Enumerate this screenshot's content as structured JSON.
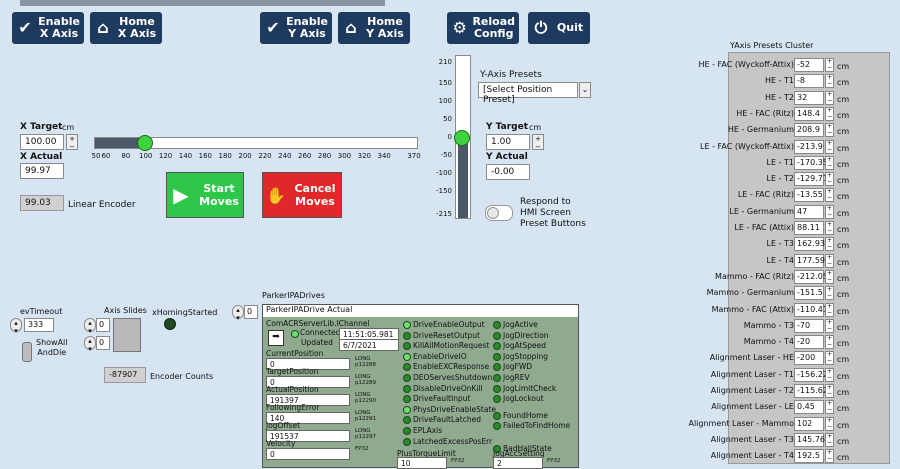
{
  "toolbar": {
    "enable_x": "Enable\nX Axis",
    "home_x": "Home\nX Axis",
    "enable_y": "Enable\nY Axis",
    "home_y": "Home\nY Axis",
    "reload": "Reload\nConfig",
    "quit": "Quit"
  },
  "xaxis": {
    "target_label": "X Target",
    "target_unit": "cm",
    "target_value": "100.00",
    "actual_label": "X Actual",
    "actual_value": "99.97",
    "encoder_value": "99.03",
    "encoder_label": "Linear Encoder",
    "slider_level": 100,
    "slider_min": 50,
    "slider_max": 370,
    "scale": [
      "50",
      "60",
      "80",
      "100",
      "120",
      "140",
      "160",
      "180",
      "200",
      "220",
      "240",
      "260",
      "280",
      "300",
      "320",
      "340",
      "370"
    ]
  },
  "moves": {
    "start": "Start\nMoves",
    "cancel": "Cancel\nMoves"
  },
  "yaxis": {
    "scale": [
      "210",
      "150",
      "100",
      "50",
      "0",
      "-50",
      "-100",
      "-150",
      "-215"
    ],
    "slider_level": 0,
    "presets_label": "Y-Axis Presets",
    "presets_selected": "[Select Position Preset]",
    "target_label": "Y Target",
    "target_unit": "cm",
    "target_value": "1.00",
    "actual_label": "Y Actual",
    "actual_value": "-0.00",
    "respond_label": "Respond to\nHMI Screen\nPreset Buttons"
  },
  "cluster": {
    "title": "YAxis Presets Cluster",
    "unit": "cm",
    "rows": [
      {
        "label": "HE - FAC (Wyckoff-Attix)",
        "value": "-52"
      },
      {
        "label": "HE - T1",
        "value": "-8"
      },
      {
        "label": "HE - T2",
        "value": "32"
      },
      {
        "label": "HE - FAC (Ritz)",
        "value": "148.4"
      },
      {
        "label": "HE - Germanium",
        "value": "208.9"
      },
      {
        "label": "LE - FAC (Wyckoff-Attix)",
        "value": "-213.9"
      },
      {
        "label": "LE - T1",
        "value": "-170.35"
      },
      {
        "label": "LE - T2",
        "value": "-129.71"
      },
      {
        "label": "LE - FAC (Ritz)",
        "value": "-13.55"
      },
      {
        "label": "LE - Germanium",
        "value": "47"
      },
      {
        "label": "LE - FAC (Attix)",
        "value": "88.11"
      },
      {
        "label": "LE - T3",
        "value": "162.93"
      },
      {
        "label": "LE - T4",
        "value": "177.59"
      },
      {
        "label": "Mammo - FAC (Ritz)",
        "value": "-212.05"
      },
      {
        "label": "Mammo - Germanium",
        "value": "-151.5"
      },
      {
        "label": "Mammo - FAC (Attix)",
        "value": "-110.41"
      },
      {
        "label": "Mammo - T3",
        "value": "-70"
      },
      {
        "label": "Mammo - T4",
        "value": "-20"
      },
      {
        "label": "Alignment Laser - HE",
        "value": "-200"
      },
      {
        "label": "Alignment Laser - T1",
        "value": "-156.22"
      },
      {
        "label": "Alignment Laser - T2",
        "value": "-115.62"
      },
      {
        "label": "Alignment Laser - LE",
        "value": "0.45"
      },
      {
        "label": "Alignment Laser - Mammo",
        "value": "102"
      },
      {
        "label": "Alignment Laser - T3",
        "value": "145.76"
      },
      {
        "label": "Alignment Laser - T4",
        "value": "192.5"
      }
    ]
  },
  "bottom": {
    "ev_timeout_label": "evTimeout",
    "ev_timeout_value": "333",
    "axis_slides_label": "Axis Slides",
    "axis_slides_a": "0",
    "axis_slides_b": "0",
    "homing_label": "xHomingStarted",
    "showall_label": "ShowAll\nAndDie",
    "encoder_counts_value": "-87907",
    "encoder_counts_label": "Encoder Counts",
    "parker_index": "0",
    "parker_label": "ParkerIPADrives"
  },
  "parker": {
    "title": "ParkerIPADrive Actual",
    "channel_label": "ComACRServerLib.IChannel",
    "connected": "Connected",
    "updated": "Updated",
    "time": "11:51:05.981 AM",
    "date": "6/7/2021",
    "fields": [
      {
        "label": "CurrentPosition",
        "value": "0",
        "type": "LONG\np12288"
      },
      {
        "label": "TargetPosition",
        "value": "0",
        "type": "LONG\np12289"
      },
      {
        "label": "ActualPosition",
        "value": "191397",
        "type": "LONG\np12290"
      },
      {
        "label": "FollowingError",
        "value": "140",
        "type": "LONG\np12291"
      },
      {
        "label": "JogOffset",
        "value": "191537",
        "type": "LONG\np12297"
      },
      {
        "label": "Velocity",
        "value": "0",
        "type": "FP32"
      }
    ],
    "col2": [
      "DriveEnableOutput",
      "DriveResetOutput",
      "KillAllMotionRequest",
      "EnableDriveIO",
      "EnableEXCResponse",
      "DEOServesShutdown",
      "DisableDriveOnKill",
      "DriveFaultInput",
      "PhysDriveEnableState",
      "DriveFaultLatched",
      "EPLAxis",
      "LatchedExcessPosErr"
    ],
    "col2_on": [
      true,
      false,
      false,
      true,
      false,
      false,
      false,
      false,
      true,
      false,
      false,
      false
    ],
    "col3": [
      "JogActive",
      "JogDirection",
      "JogAtSpeed",
      "JogStopping",
      "JogFWD",
      "JogREV",
      "JogLimitCheck",
      "JogLockout",
      "FoundHome",
      "FailedToFindHome",
      "BadHallState"
    ],
    "plus_torque_label": "PlusTorqueLimit",
    "plus_torque_value": "10",
    "plus_torque_type": "FP32",
    "jog_acc_label": "JogAccSetting",
    "jog_acc_value": "2",
    "jog_acc_type": "FP32"
  }
}
